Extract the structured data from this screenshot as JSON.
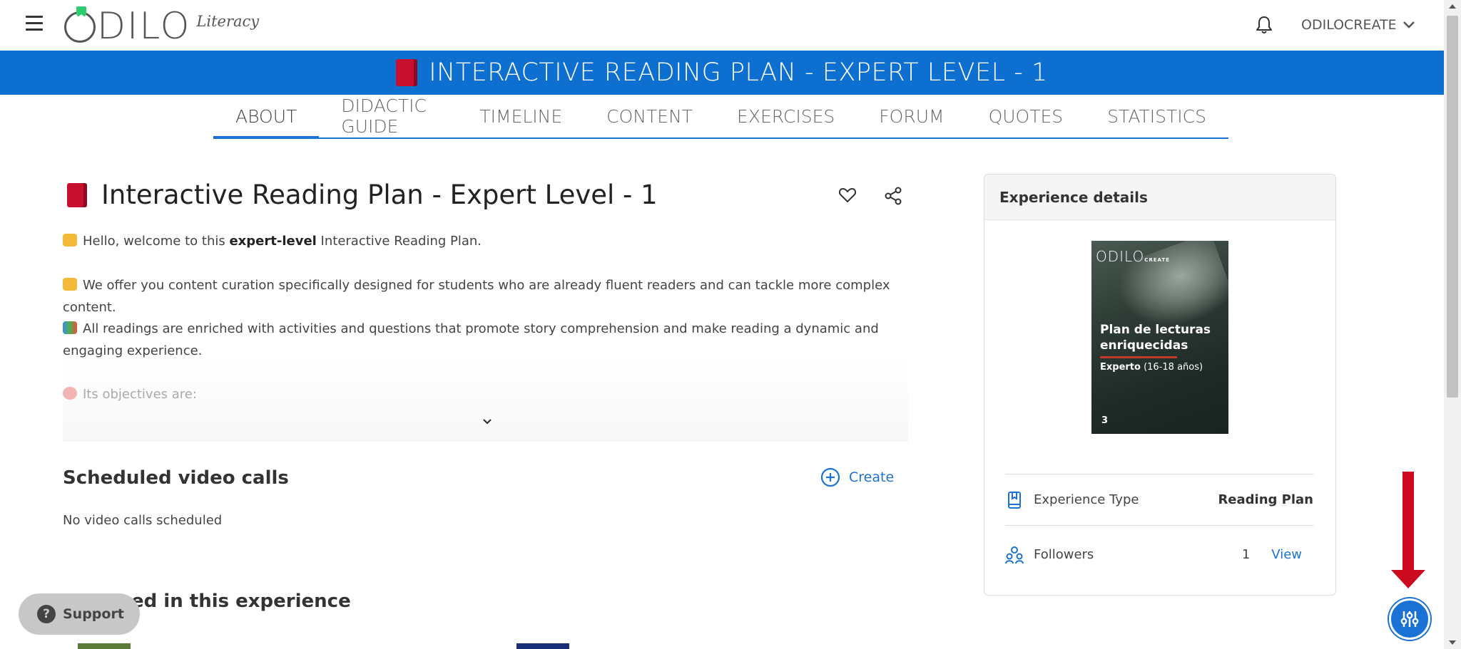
{
  "header": {
    "logo_text": "ODILO",
    "logo_sub": "Literacy",
    "user_name": "ODILOCREATE"
  },
  "titlebar": {
    "title": "INTERACTIVE READING PLAN - EXPERT LEVEL - 1"
  },
  "tabs": [
    {
      "label": "ABOUT",
      "active": true
    },
    {
      "label": "DIDACTIC GUIDE"
    },
    {
      "label": "TIMELINE"
    },
    {
      "label": "CONTENT"
    },
    {
      "label": "EXERCISES"
    },
    {
      "label": "FORUM"
    },
    {
      "label": "QUOTES"
    },
    {
      "label": "STATISTICS"
    }
  ],
  "main": {
    "title": "Interactive Reading Plan - Expert Level - 1",
    "p1_pre": "Hello, welcome to this ",
    "p1_bold": "expert-level",
    "p1_post": " Interactive Reading Plan.",
    "p2": "We offer you content curation specifically designed for students who are already fluent readers and can tackle more complex content.",
    "p3": "All readings are enriched with activities and questions that promote story comprehension and make reading a dynamic and engaging experience.",
    "p4": "Its objectives are:",
    "video_calls_title": "Scheduled video calls",
    "create_label": "Create",
    "no_calls": "No video calls scheduled",
    "included_partial": "ed in this experience"
  },
  "card": {
    "title": "Experience details",
    "cover": {
      "logo": "ODILO",
      "logo_tag": "CREATE",
      "title_line1": "Plan de lecturas",
      "title_line2": "enriquecidas",
      "sub_bold": "Experto",
      "sub_rest": " (16-18 años)",
      "number": "3"
    },
    "type_label": "Experience Type",
    "type_value": "Reading Plan",
    "followers_label": "Followers",
    "followers_count": "1",
    "view_label": "View"
  },
  "support": {
    "label": "Support"
  },
  "colors": {
    "brand_blue": "#0d6fcf",
    "accent_blue": "#1a73d4",
    "arrow_red": "#cc0a1f"
  }
}
